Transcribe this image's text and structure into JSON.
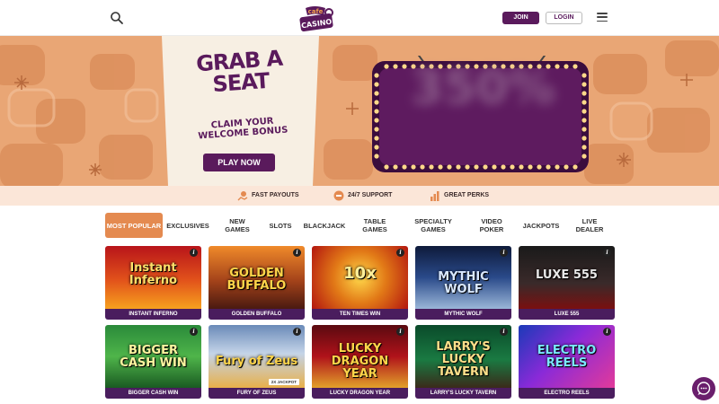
{
  "header": {
    "join_label": "JOIN",
    "login_label": "LOGIN",
    "logo_top": "cafe",
    "logo_bottom": "CASINO",
    "icons": [
      "search-icon",
      "menu-icon"
    ]
  },
  "hero": {
    "title": "GRAB A SEAT",
    "subtitle": "CLAIM YOUR WELCOME BONUS",
    "cta_label": "PLAY NOW",
    "sign_text": "350%"
  },
  "perks": [
    {
      "label": "FAST PAYOUTS",
      "icon": "hand-coin-icon"
    },
    {
      "label": "24/7 SUPPORT",
      "icon": "support-icon"
    },
    {
      "label": "GREAT PERKS",
      "icon": "bar-chart-icon"
    }
  ],
  "tabs": [
    {
      "label": "MOST POPULAR",
      "active": true
    },
    {
      "label": "EXCLUSIVES"
    },
    {
      "label": "NEW GAMES"
    },
    {
      "label": "SLOTS"
    },
    {
      "label": "BLACKJACK"
    },
    {
      "label": "TABLE GAMES"
    },
    {
      "label": "SPECIALTY GAMES"
    },
    {
      "label": "VIDEO POKER"
    },
    {
      "label": "JACKPOTS"
    },
    {
      "label": "LIVE DEALER"
    }
  ],
  "games": [
    {
      "name": "INSTANT INFERNO",
      "art": "Instant Inferno"
    },
    {
      "name": "GOLDEN BUFFALO",
      "art": "GOLDEN BUFFALO"
    },
    {
      "name": "TEN TIMES WIN",
      "art": "10x"
    },
    {
      "name": "MYTHIC WOLF",
      "art": "MYTHIC WOLF"
    },
    {
      "name": "LUXE 555",
      "art": "LUXE 555"
    },
    {
      "name": "BIGGER CASH WIN",
      "art": "BIGGER CASH WIN"
    },
    {
      "name": "FURY OF ZEUS",
      "art": "Fury of Zeus",
      "badge": "2X JACKPOT"
    },
    {
      "name": "LUCKY DRAGON YEAR",
      "art": "LUCKY DRAGON YEAR"
    },
    {
      "name": "LARRY'S LUCKY TAVERN",
      "art": "LARRY'S LUCKY TAVERN"
    },
    {
      "name": "ELECTRO REELS",
      "art": "ELECTRO REELS"
    }
  ],
  "info_glyph": "i",
  "colors": {
    "brand": "#5a1a5c",
    "accent": "#e48a50",
    "hero_bg": "#e8a26f",
    "perks_bg": "#fbe6d8"
  }
}
